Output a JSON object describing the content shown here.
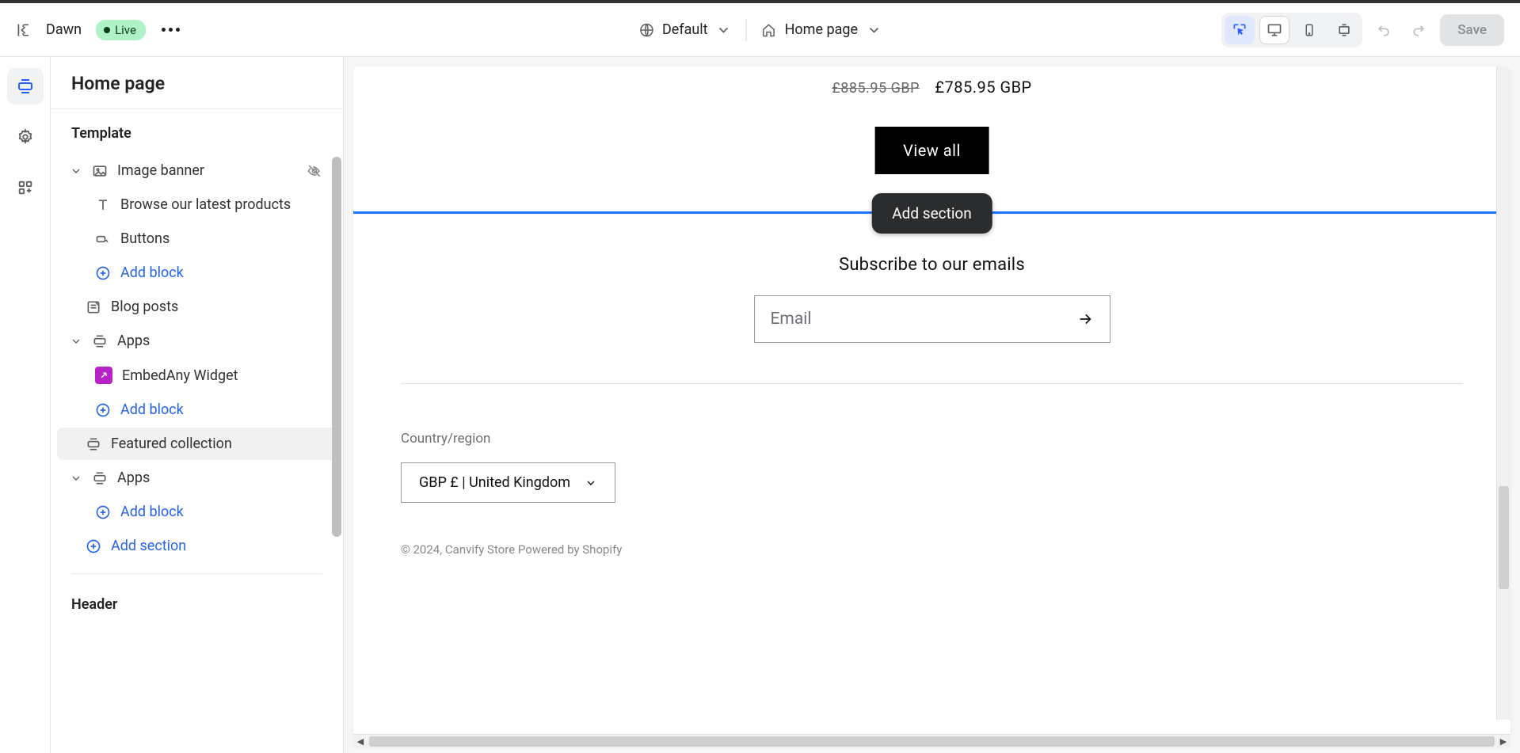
{
  "topbar": {
    "theme": "Dawn",
    "badge": "Live",
    "dropdown1": "Default",
    "dropdown2": "Home page",
    "save": "Save"
  },
  "sidebar": {
    "title": "Home page",
    "groups": {
      "template": "Template",
      "header": "Header"
    },
    "items": {
      "image_banner": "Image banner",
      "browse_latest": "Browse our latest products",
      "buttons": "Buttons",
      "add_block": "Add block",
      "blog_posts": "Blog posts",
      "apps": "Apps",
      "embedany": "EmbedAny Widget",
      "featured": "Featured collection",
      "apps2": "Apps",
      "add_section": "Add section"
    }
  },
  "preview": {
    "price_old": "£885.95 GBP",
    "price_new": "£785.95 GBP",
    "view_all": "View all",
    "add_section_tooltip": "Add section",
    "subscribe_heading": "Subscribe to our emails",
    "email_placeholder": "Email",
    "country_label": "Country/region",
    "country_value": "GBP £ | United Kingdom",
    "copyright": "© 2024, Canvify Store Powered by Shopify"
  }
}
